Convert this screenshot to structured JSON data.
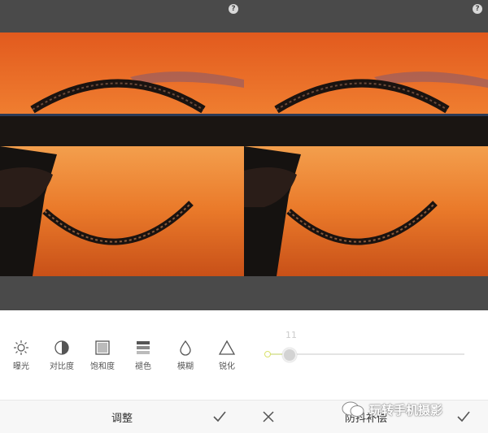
{
  "left_panel": {
    "help_icon": "?",
    "tools": [
      {
        "name": "exposure",
        "label": "曝光",
        "icon": "sun-icon"
      },
      {
        "name": "contrast",
        "label": "对比度",
        "icon": "contrast-icon"
      },
      {
        "name": "saturation",
        "label": "饱和度",
        "icon": "saturation-icon"
      },
      {
        "name": "fade",
        "label": "褪色",
        "icon": "fade-icon"
      },
      {
        "name": "blur",
        "label": "模糊",
        "icon": "drop-icon"
      },
      {
        "name": "sharpen",
        "label": "锐化",
        "icon": "triangle-icon"
      }
    ],
    "footer_title": "调整"
  },
  "right_panel": {
    "help_icon": "?",
    "slider": {
      "value_text": "11",
      "value": 0.11
    },
    "footer_title": "防抖补偿",
    "watermark": "玩转手机摄影"
  },
  "colors": {
    "dark_bar": "#4a4a4a",
    "slider_accent": "#d9e26c",
    "sky_top": "#f07a2a",
    "sky_mid": "#f7a447",
    "water": "#e0702a"
  }
}
